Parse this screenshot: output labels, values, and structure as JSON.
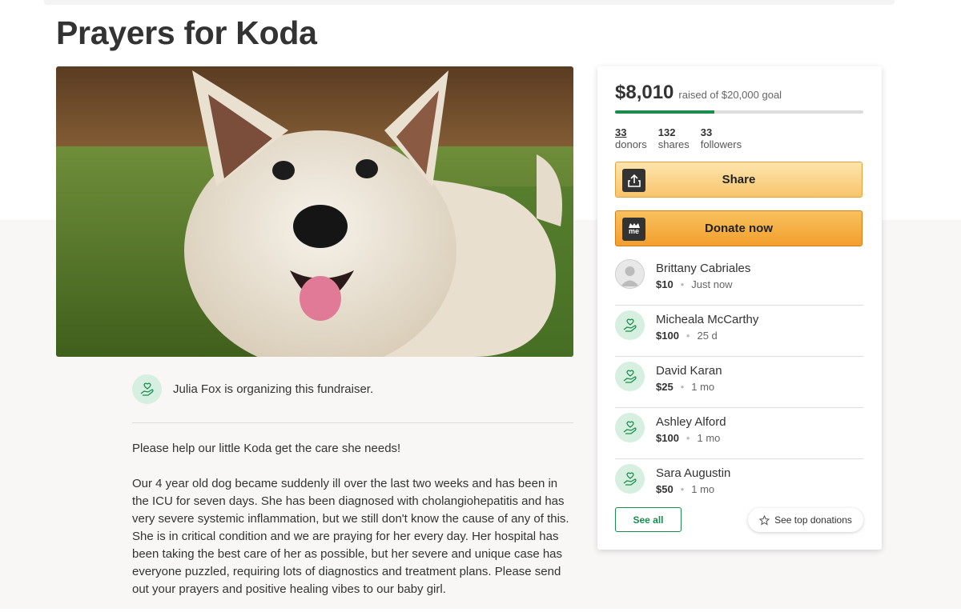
{
  "page": {
    "title": "Prayers for Koda"
  },
  "fundraiser": {
    "raised": "$8,010",
    "goal_text": "raised of $20,000 goal",
    "progress_fraction": 0.4,
    "accent_color": "#1a8c4e",
    "stats": [
      {
        "value": "33",
        "label": "donors"
      },
      {
        "value": "132",
        "label": "shares"
      },
      {
        "value": "33",
        "label": "followers"
      }
    ]
  },
  "buttons": {
    "share": "Share",
    "donate": "Donate now",
    "donate_icon_text": "me",
    "see_all": "See all",
    "see_top": "See top donations"
  },
  "donations": [
    {
      "name": "Brittany Cabriales",
      "amount": "$10",
      "time": "Just now",
      "avatar": "profile-photo"
    },
    {
      "name": "Micheala McCarthy",
      "amount": "$100",
      "time": "25 d",
      "avatar": "heart-hand-icon"
    },
    {
      "name": "David Karan",
      "amount": "$25",
      "time": "1 mo",
      "avatar": "heart-hand-icon"
    },
    {
      "name": "Ashley Alford",
      "amount": "$100",
      "time": "1 mo",
      "avatar": "heart-hand-icon"
    },
    {
      "name": "Sara Augustin",
      "amount": "$50",
      "time": "1 mo",
      "avatar": "heart-hand-icon"
    }
  ],
  "organizer": {
    "text": "Julia Fox is organizing this fundraiser."
  },
  "story": [
    "Please help our little Koda get the care she needs!",
    "Our 4 year old dog became suddenly ill over the last two weeks and has been in the ICU for seven days.  She has been diagnosed with cholangiohepatitis and has very severe systemic inflammation, but we still don't know the cause of any of this. She is in critical condition and we are praying for her every day.  Her hospital has been taking the best care of her as possible, but her severe and unique case has everyone puzzled, requiring lots of diagnostics and treatment plans. Please send out your prayers and positive healing vibes to our baby girl."
  ]
}
